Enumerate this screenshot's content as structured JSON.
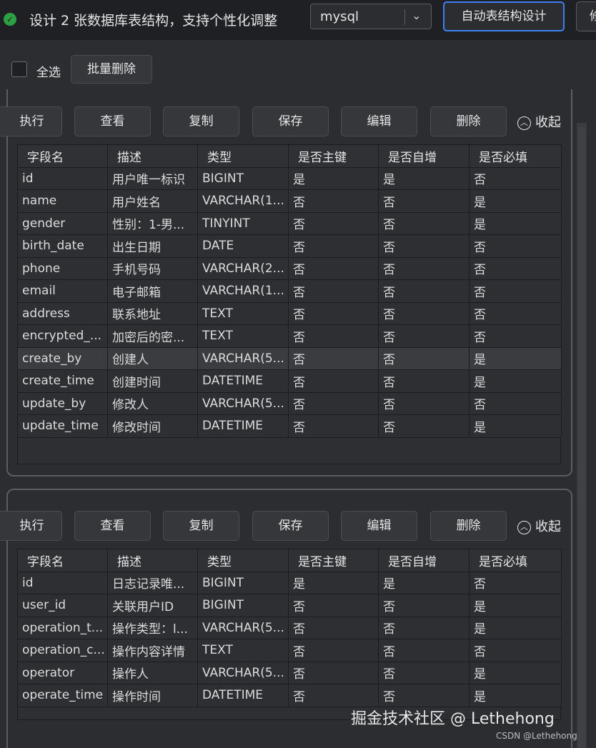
{
  "header": {
    "status_icon": "check-circle-icon",
    "title": "设计 2 张数据库表结构，支持个性化调整",
    "db_select": {
      "value": "mysql",
      "icon": "chevron-down-icon"
    },
    "auto_design_button": "自动表结构设计",
    "cut_button": "修"
  },
  "toolbar": {
    "select_all_label": "全选",
    "batch_delete_label": "批量删除"
  },
  "panel_actions": {
    "execute": "执行",
    "view": "查看",
    "copy": "复制",
    "save": "保存",
    "edit": "编辑",
    "delete": "删除",
    "collapse": "收起",
    "collapse_icon": "chevron-up-icon"
  },
  "columns": [
    "字段名",
    "描述",
    "类型",
    "是否主键",
    "是否自增",
    "是否必填"
  ],
  "table1": {
    "rows": [
      [
        "id",
        "用户唯一标识",
        "BIGINT",
        "是",
        "是",
        "否"
      ],
      [
        "name",
        "用户姓名",
        "VARCHAR(1...",
        "否",
        "否",
        "是"
      ],
      [
        "gender",
        "性别：1-男...",
        "TINYINT",
        "否",
        "否",
        "是"
      ],
      [
        "birth_date",
        "出生日期",
        "DATE",
        "否",
        "否",
        "否"
      ],
      [
        "phone",
        "手机号码",
        "VARCHAR(2...",
        "否",
        "否",
        "否"
      ],
      [
        "email",
        "电子邮箱",
        "VARCHAR(1...",
        "否",
        "否",
        "否"
      ],
      [
        "address",
        "联系地址",
        "TEXT",
        "否",
        "否",
        "否"
      ],
      [
        "encrypted_...",
        "加密后的密...",
        "TEXT",
        "否",
        "否",
        "否"
      ],
      [
        "create_by",
        "创建人",
        "VARCHAR(5...",
        "否",
        "否",
        "是"
      ],
      [
        "create_time",
        "创建时间",
        "DATETIME",
        "否",
        "否",
        "是"
      ],
      [
        "update_by",
        "修改人",
        "VARCHAR(5...",
        "否",
        "否",
        "否"
      ],
      [
        "update_time",
        "修改时间",
        "DATETIME",
        "否",
        "否",
        "是"
      ]
    ]
  },
  "table2": {
    "rows": [
      [
        "id",
        "日志记录唯...",
        "BIGINT",
        "是",
        "是",
        "否"
      ],
      [
        "user_id",
        "关联用户ID",
        "BIGINT",
        "否",
        "否",
        "是"
      ],
      [
        "operation_t...",
        "操作类型：l...",
        "VARCHAR(5...",
        "否",
        "否",
        "是"
      ],
      [
        "operation_c...",
        "操作内容详情",
        "TEXT",
        "否",
        "否",
        "否"
      ],
      [
        "operator",
        "操作人",
        "VARCHAR(5...",
        "否",
        "否",
        "是"
      ],
      [
        "operate_time",
        "操作时间",
        "DATETIME",
        "否",
        "否",
        "是"
      ]
    ]
  },
  "watermark": {
    "main": "掘金技术社区 @ Lethehong",
    "sub": "CSDN @Lethehong"
  },
  "colors": {
    "accent": "#3b82f6",
    "success": "#2ea043",
    "background": "#2b2d30"
  }
}
